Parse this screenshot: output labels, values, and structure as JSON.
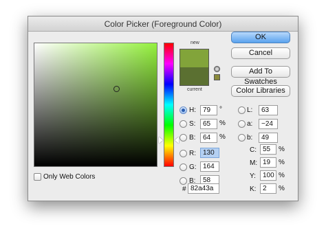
{
  "window": {
    "title": "Color Picker (Foreground Color)"
  },
  "preview": {
    "new_label": "new",
    "current_label": "current",
    "new_color": "#82a43a",
    "current_color": "#5b7031"
  },
  "buttons": {
    "ok": "OK",
    "cancel": "Cancel",
    "add_to_swatches": "Add To Swatches",
    "color_libraries": "Color Libraries"
  },
  "hsb": {
    "h_label": "H:",
    "h_value": "79",
    "h_unit": "°",
    "s_label": "S:",
    "s_value": "65",
    "s_unit": "%",
    "b_label": "B:",
    "b_value": "64",
    "b_unit": "%"
  },
  "rgb": {
    "r_label": "R:",
    "r_value": "130",
    "g_label": "G:",
    "g_value": "164",
    "b_label": "B:",
    "b_value": "58"
  },
  "lab": {
    "l_label": "L:",
    "l_value": "63",
    "a_label": "a:",
    "a_value": "−24",
    "b_label": "b:",
    "b_value": "49"
  },
  "cmyk": {
    "c_label": "C:",
    "c_value": "55",
    "m_label": "M:",
    "m_value": "19",
    "y_label": "Y:",
    "y_value": "100",
    "k_label": "K:",
    "k_value": "2",
    "unit": "%"
  },
  "hex": {
    "label": "#",
    "value": "82a43a"
  },
  "options": {
    "only_web_colors": "Only Web Colors",
    "only_web_colors_checked": false
  },
  "selected_mode": "H",
  "field_hue_color": "#94f13d"
}
